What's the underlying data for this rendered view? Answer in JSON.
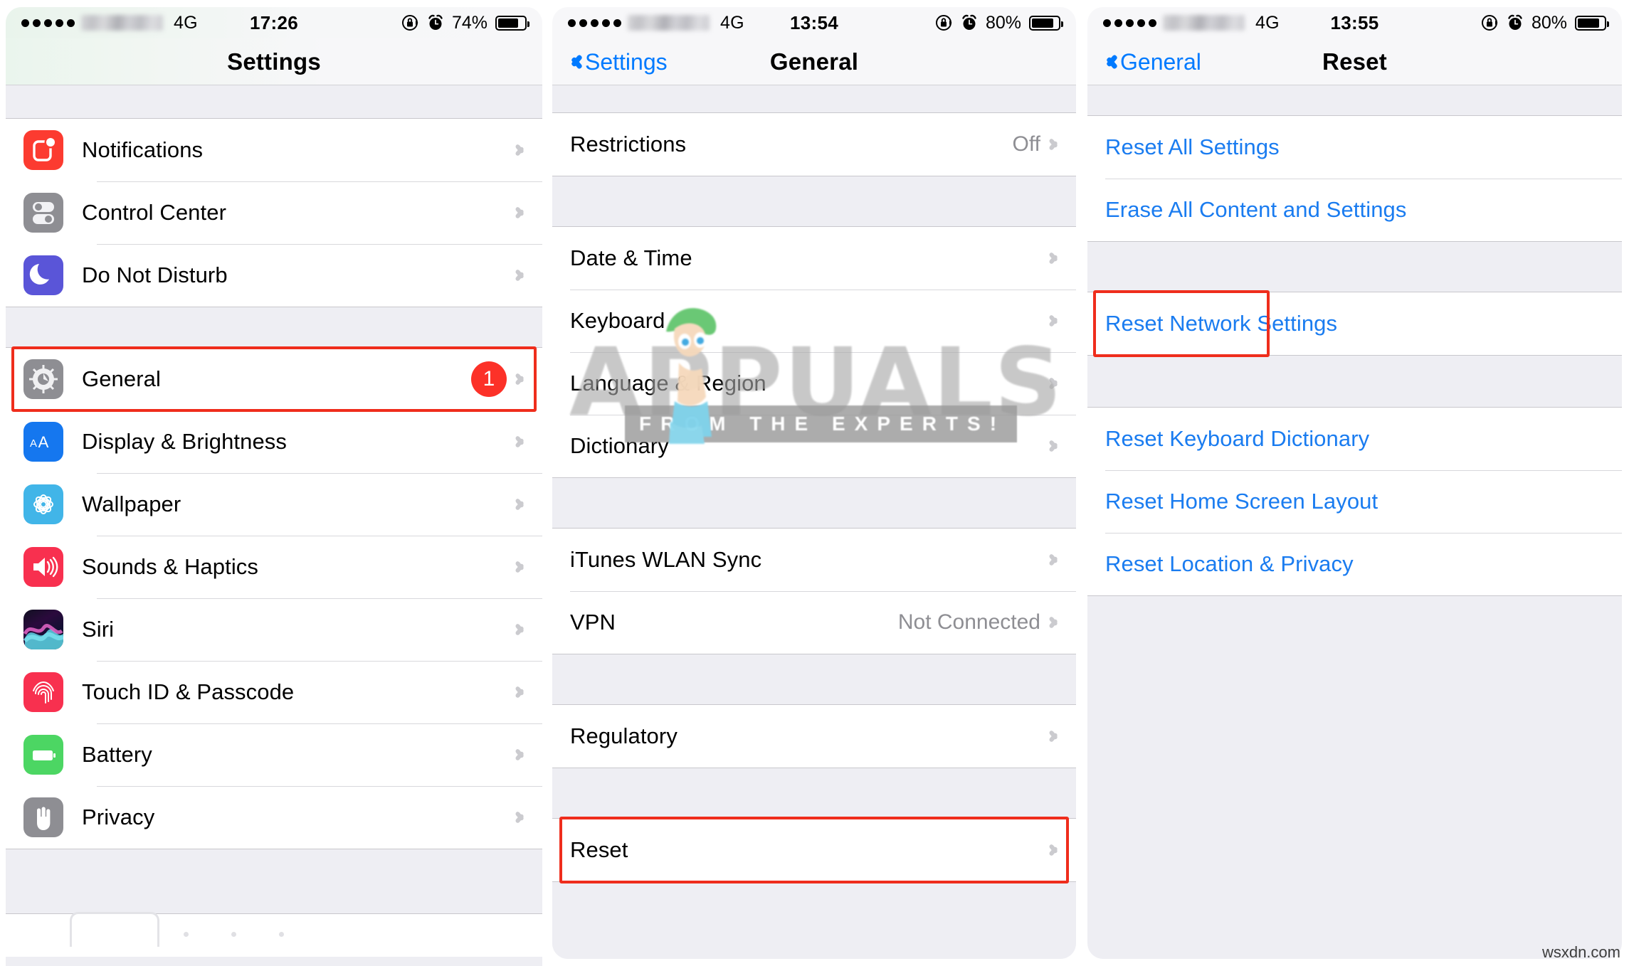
{
  "meta": {
    "watermark_site": "wsxdn.com",
    "brand_watermark": "APPUALS",
    "brand_tagline": "FROM THE EXPERTS!"
  },
  "colors": {
    "accent_blue": "#007aff",
    "link_blue": "#1a7cf0",
    "highlight_red": "#ef2d1c",
    "badge_red": "#fc3128",
    "group_bg": "#eeeef3"
  },
  "panels": [
    {
      "id": "settings",
      "status": {
        "network": "4G",
        "time": "17:26",
        "battery_percent": "74%",
        "signal_dots": 5,
        "icons": [
          "rotation-lock-icon",
          "alarm-clock-icon",
          "battery-icon"
        ]
      },
      "nav": {
        "title": "Settings",
        "back_label": ""
      },
      "groups": [
        {
          "rows": [
            {
              "label": "Notifications",
              "icon": "notifications-icon",
              "value": "",
              "badge": "",
              "chevron": true
            },
            {
              "label": "Control Center",
              "icon": "control-center-icon",
              "value": "",
              "badge": "",
              "chevron": true
            },
            {
              "label": "Do Not Disturb",
              "icon": "do-not-disturb-icon",
              "value": "",
              "badge": "",
              "chevron": true
            }
          ]
        },
        {
          "rows": [
            {
              "label": "General",
              "icon": "general-gear-icon",
              "value": "",
              "badge": "1",
              "chevron": true,
              "highlight": true
            },
            {
              "label": "Display & Brightness",
              "icon": "display-brightness-icon",
              "value": "",
              "badge": "",
              "chevron": true
            },
            {
              "label": "Wallpaper",
              "icon": "wallpaper-icon",
              "value": "",
              "badge": "",
              "chevron": true
            },
            {
              "label": "Sounds & Haptics",
              "icon": "sounds-haptics-icon",
              "value": "",
              "badge": "",
              "chevron": true
            },
            {
              "label": "Siri",
              "icon": "siri-icon",
              "value": "",
              "badge": "",
              "chevron": true
            },
            {
              "label": "Touch ID & Passcode",
              "icon": "touch-id-icon",
              "value": "",
              "badge": "",
              "chevron": true
            },
            {
              "label": "Battery",
              "icon": "battery-app-icon",
              "value": "",
              "badge": "",
              "chevron": true
            },
            {
              "label": "Privacy",
              "icon": "privacy-hand-icon",
              "value": "",
              "badge": "",
              "chevron": true
            }
          ]
        }
      ]
    },
    {
      "id": "general",
      "status": {
        "network": "4G",
        "time": "13:54",
        "battery_percent": "80%",
        "signal_dots": 5,
        "icons": [
          "rotation-lock-icon",
          "alarm-clock-icon",
          "battery-icon"
        ]
      },
      "nav": {
        "title": "General",
        "back_label": "Settings"
      },
      "groups": [
        {
          "rows": [
            {
              "label": "Restrictions",
              "value": "Off",
              "chevron": true
            }
          ]
        },
        {
          "rows": [
            {
              "label": "Date & Time",
              "value": "",
              "chevron": true
            },
            {
              "label": "Keyboard",
              "value": "",
              "chevron": true
            },
            {
              "label": "Language & Region",
              "value": "",
              "chevron": true
            },
            {
              "label": "Dictionary",
              "value": "",
              "chevron": true
            }
          ]
        },
        {
          "rows": [
            {
              "label": "iTunes WLAN Sync",
              "value": "",
              "chevron": true
            },
            {
              "label": "VPN",
              "value": "Not Connected",
              "chevron": true
            }
          ]
        },
        {
          "rows": [
            {
              "label": "Regulatory",
              "value": "",
              "chevron": true
            }
          ]
        },
        {
          "rows": [
            {
              "label": "Reset",
              "value": "",
              "chevron": true,
              "highlight": true
            }
          ]
        }
      ]
    },
    {
      "id": "reset",
      "status": {
        "network": "4G",
        "time": "13:55",
        "battery_percent": "80%",
        "signal_dots": 5,
        "icons": [
          "rotation-lock-icon",
          "alarm-clock-icon",
          "battery-icon"
        ]
      },
      "nav": {
        "title": "Reset",
        "back_label": "General"
      },
      "groups": [
        {
          "rows": [
            {
              "label": "Reset All Settings",
              "link": true
            },
            {
              "label": "Erase All Content and Settings",
              "link": true
            }
          ]
        },
        {
          "rows": [
            {
              "label": "Reset Network Settings",
              "link": true,
              "highlight": true
            }
          ]
        },
        {
          "rows": [
            {
              "label": "Reset Keyboard Dictionary",
              "link": true
            },
            {
              "label": "Reset Home Screen Layout",
              "link": true
            },
            {
              "label": "Reset Location & Privacy",
              "link": true
            }
          ]
        }
      ]
    }
  ]
}
